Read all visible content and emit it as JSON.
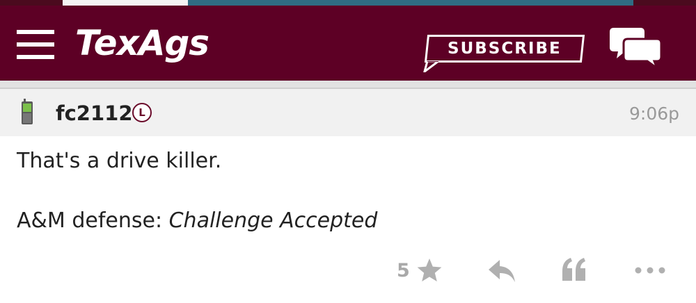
{
  "header": {
    "logo_text": "TexAgs",
    "subscribe_label": "SUBSCRIBE",
    "background_color": "#5d0025"
  },
  "post": {
    "username": "fc2112",
    "badge": "L",
    "timestamp": "9:06p",
    "body_line1": "That's a drive killer.",
    "body_line2_prefix": "A&M defense: ",
    "body_line2_emphasis": "Challenge Accepted"
  },
  "actions": {
    "star_count": "5"
  },
  "icons": {
    "menu": "menu-icon",
    "chat": "chat-icon",
    "device": "mobile-phone-icon",
    "star": "star-icon",
    "reply": "reply-icon",
    "quote": "quote-icon",
    "more": "more-icon"
  }
}
